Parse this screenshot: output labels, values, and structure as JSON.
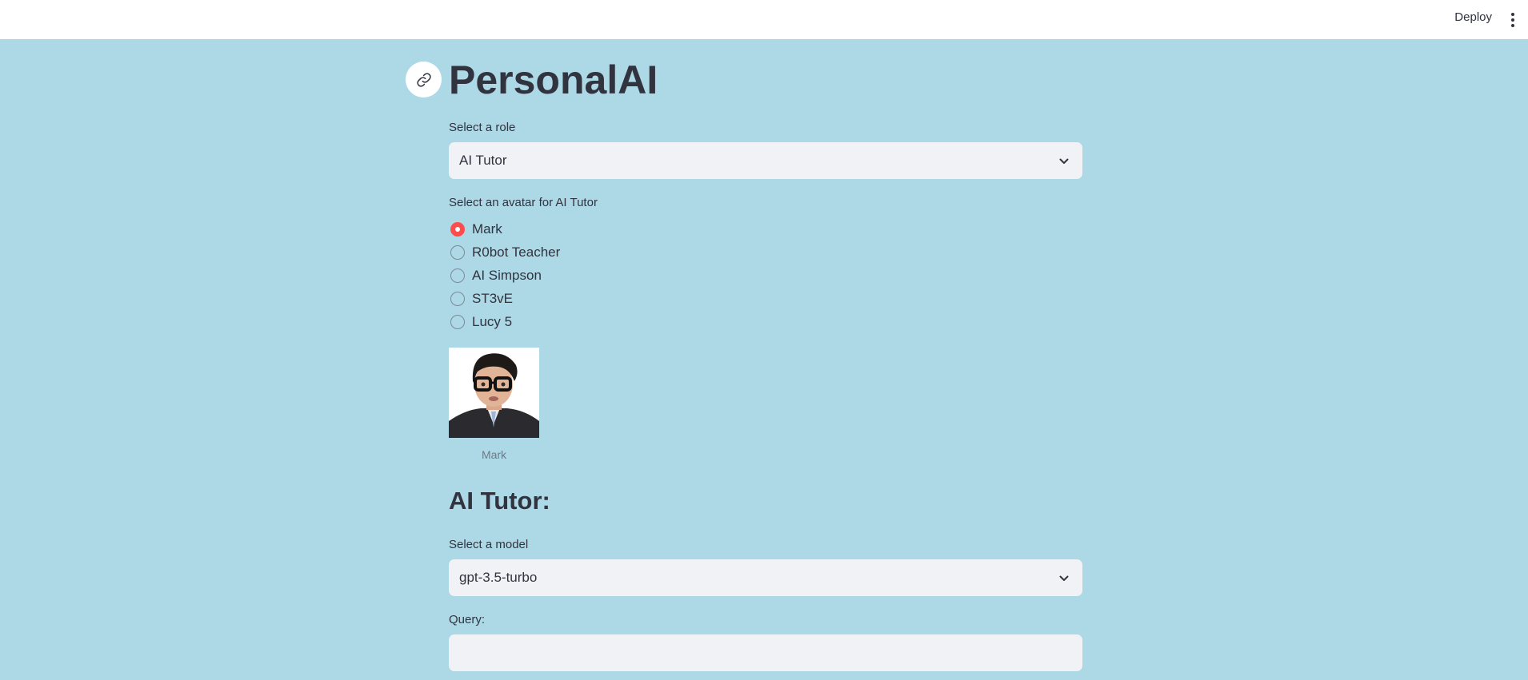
{
  "header": {
    "deploy_label": "Deploy",
    "menu_icon": "more-vertical-icon"
  },
  "page": {
    "title": "PersonalAI",
    "link_icon": "link-icon",
    "background_color": "#add8e6",
    "accent_color": "#ff4b4b"
  },
  "role_select": {
    "label": "Select a role",
    "value": "AI Tutor"
  },
  "avatar_select": {
    "label": "Select an avatar for AI Tutor",
    "options": [
      "Mark",
      "R0bot Teacher",
      "AI Simpson",
      "ST3vE",
      "Lucy 5"
    ],
    "selected": "Mark"
  },
  "avatar_image": {
    "caption": "Mark"
  },
  "section": {
    "heading": "AI Tutor:"
  },
  "model_select": {
    "label": "Select a model",
    "value": "gpt-3.5-turbo"
  },
  "query": {
    "label": "Query:",
    "value": "",
    "placeholder": ""
  }
}
